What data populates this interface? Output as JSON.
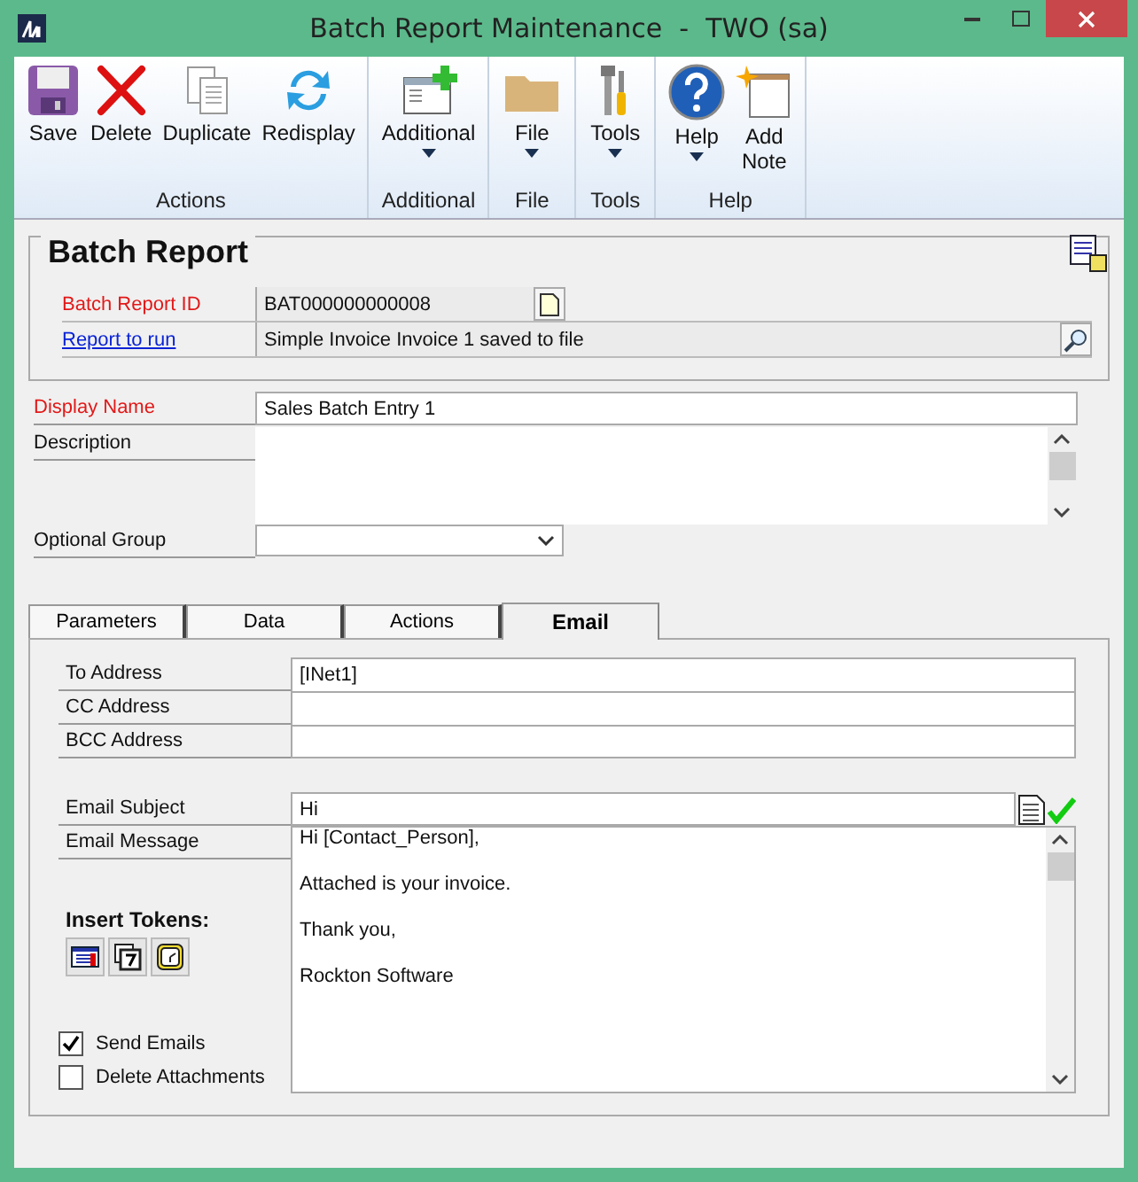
{
  "window": {
    "title": "Batch Report Maintenance  -  TWO (sa)"
  },
  "ribbon": {
    "groups": [
      {
        "label": "Actions",
        "buttons": [
          {
            "label": "Save",
            "kind": "save",
            "dropdown": false
          },
          {
            "label": "Delete",
            "kind": "delete",
            "dropdown": false
          },
          {
            "label": "Duplicate",
            "kind": "duplicate",
            "dropdown": false
          },
          {
            "label": "Redisplay",
            "kind": "redisplay",
            "dropdown": false
          }
        ]
      },
      {
        "label": "Additional",
        "buttons": [
          {
            "label": "Additional",
            "kind": "additional",
            "dropdown": true
          }
        ]
      },
      {
        "label": "File",
        "buttons": [
          {
            "label": "File",
            "kind": "file",
            "dropdown": true
          }
        ]
      },
      {
        "label": "Tools",
        "buttons": [
          {
            "label": "Tools",
            "kind": "tools",
            "dropdown": true
          }
        ]
      },
      {
        "label": "Help",
        "buttons": [
          {
            "label": "Help",
            "kind": "help",
            "dropdown": true
          },
          {
            "label": "Add Note",
            "kind": "note",
            "dropdown": false
          }
        ]
      }
    ]
  },
  "header": {
    "title": "Batch Report",
    "batch_report_id": {
      "label": "Batch Report ID",
      "value": "BAT000000000008"
    },
    "report_to_run": {
      "label": "Report to run",
      "value": "Simple Invoice Invoice 1 saved to file"
    }
  },
  "display_name": {
    "label": "Display Name",
    "value": "Sales Batch Entry 1"
  },
  "description": {
    "label": "Description"
  },
  "optional_group": {
    "label": "Optional Group"
  },
  "tabs": [
    {
      "label": "Parameters",
      "selected": false
    },
    {
      "label": "Data",
      "selected": false
    },
    {
      "label": "Actions",
      "selected": false
    },
    {
      "label": "Email",
      "selected": true
    }
  ],
  "email": {
    "addresses": [
      {
        "label": "To Address",
        "value": "[INet1]"
      },
      {
        "label": "CC Address"
      },
      {
        "label": "BCC Address"
      }
    ],
    "subject": {
      "label": "Email Subject",
      "value": "Hi"
    },
    "message": {
      "label": "Email Message",
      "lines": [
        "Hi [Contact_Person],",
        "Attached is your invoice.",
        "Thank you,",
        "Rockton Software"
      ]
    },
    "insert_tokens": "Insert Tokens:",
    "options": [
      {
        "label": "Send Emails",
        "checked": true
      },
      {
        "label": "Delete Attachments",
        "checked": false
      }
    ]
  }
}
